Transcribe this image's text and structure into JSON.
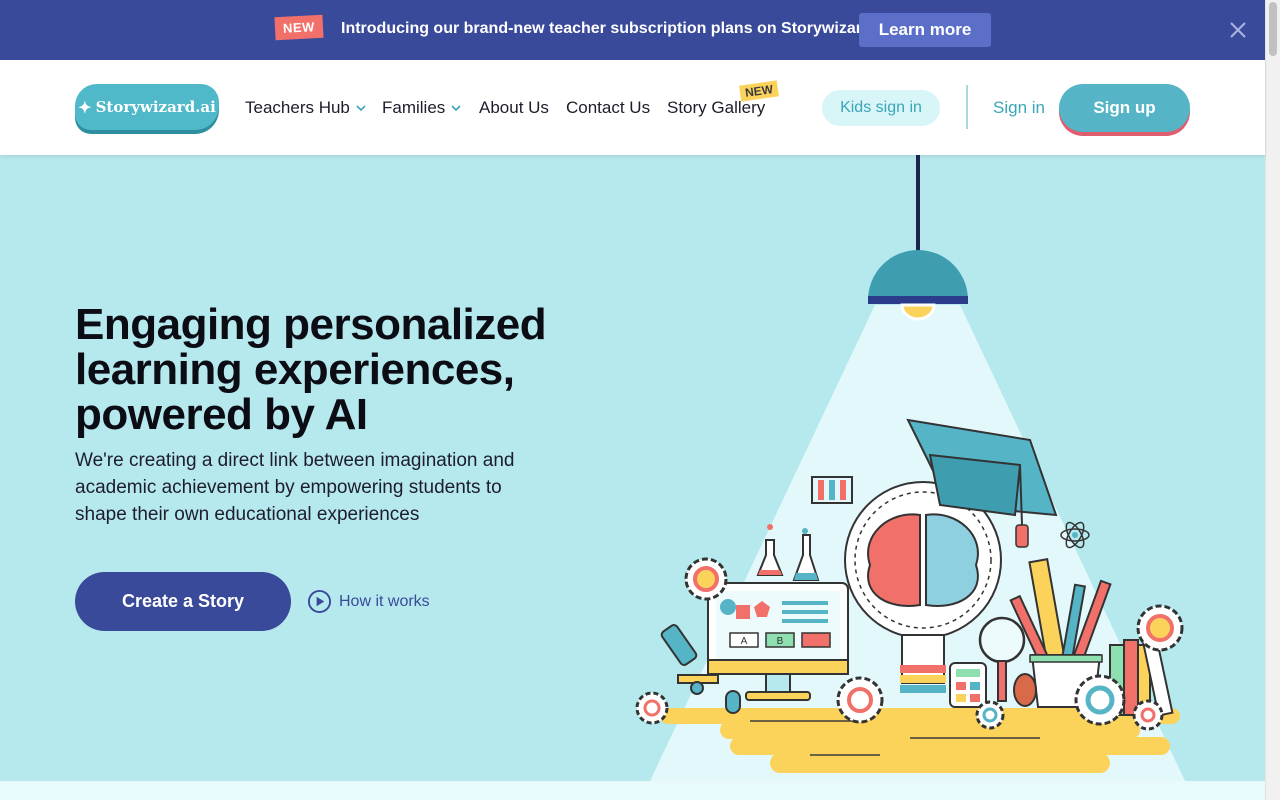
{
  "announcement": {
    "badge": "NEW",
    "message": "Introducing our brand-new teacher subscription plans on Storywizard.ai",
    "learn_more": "Learn more",
    "close_icon": "close-icon"
  },
  "header": {
    "logo_text": "Storywizard.ai",
    "nav": {
      "teachers_hub": "Teachers Hub",
      "families": "Families",
      "about": "About Us",
      "contact": "Contact Us",
      "gallery": "Story Gallery",
      "gallery_badge": "NEW"
    },
    "kids_sign_in": "Kids sign in",
    "sign_in": "Sign in",
    "sign_up": "Sign up"
  },
  "hero": {
    "title": "Engaging personalized learning experiences, powered by AI",
    "subtitle": "We're creating a direct link between imagination and academic achievement by empowering students to shape their own educational experiences",
    "cta": "Create a Story",
    "how_it_works": "How it works",
    "illustration_labels": {
      "a": "A",
      "b": "B"
    }
  },
  "colors": {
    "navy": "#3a4a9a",
    "teal": "#55b4c6",
    "hero_bg": "#b6e9ee",
    "coral": "#f2706a",
    "yellow": "#fbd35b"
  }
}
